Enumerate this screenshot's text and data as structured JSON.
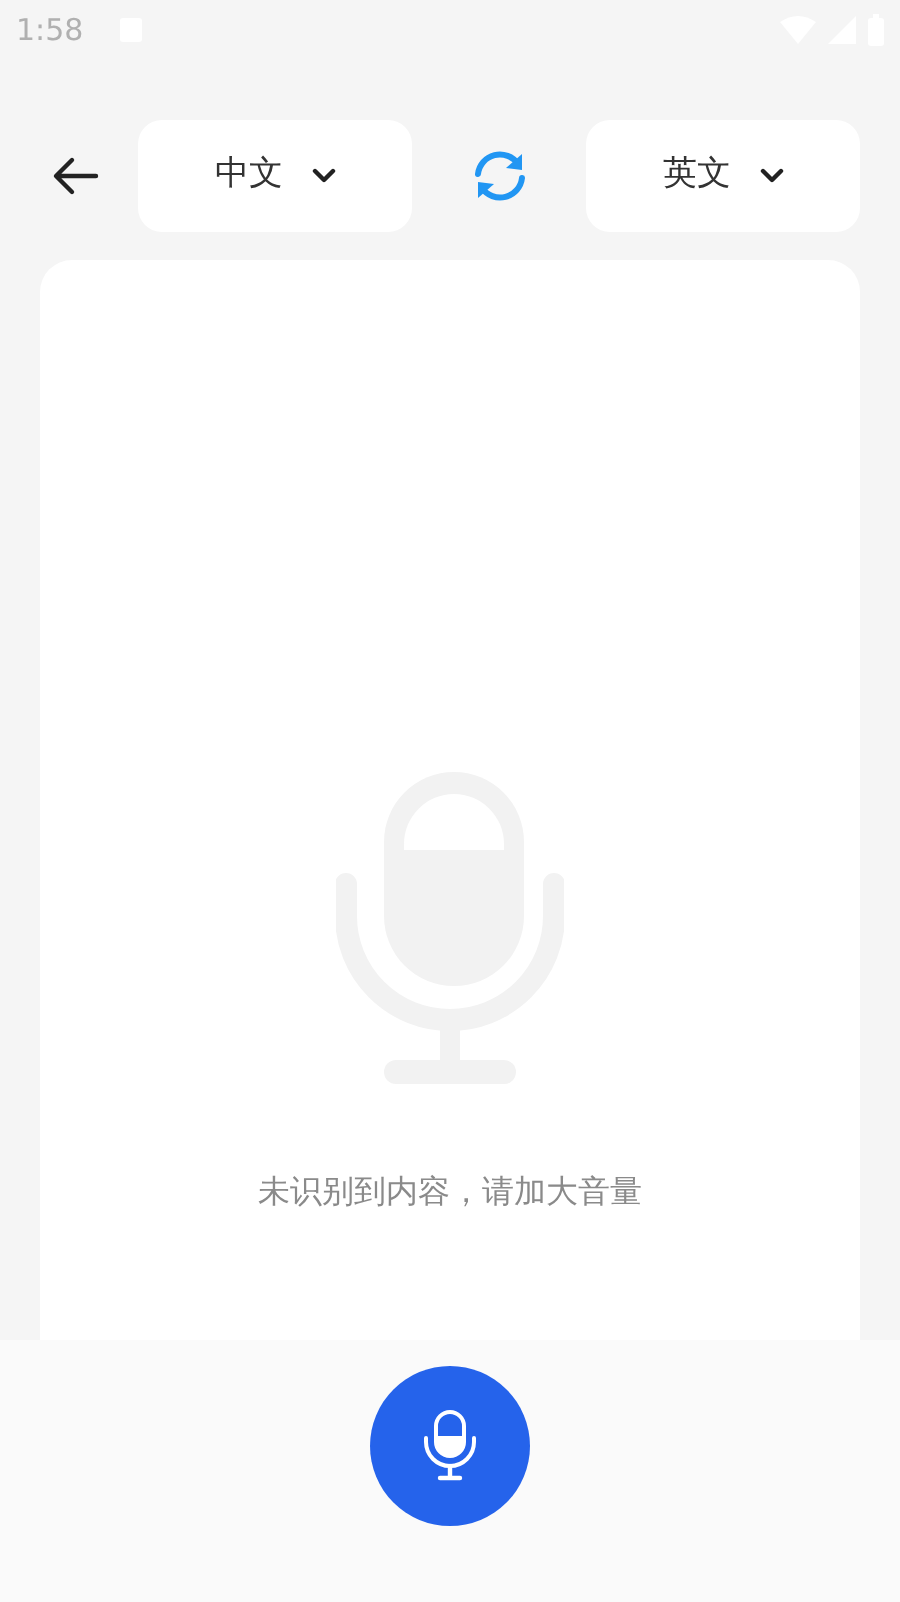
{
  "status_bar": {
    "time": "1:58"
  },
  "header": {
    "source_language": "中文",
    "target_language": "英文"
  },
  "result": {
    "message": "未识别到内容，请加大音量"
  }
}
